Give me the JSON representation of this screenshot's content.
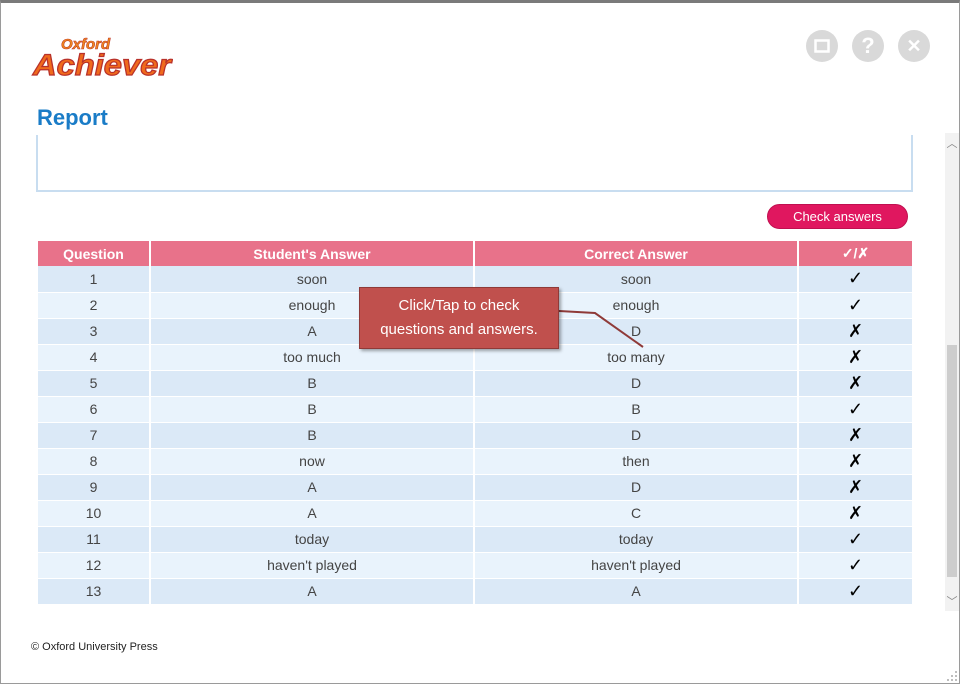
{
  "logo": {
    "top_word": "Oxford",
    "main_word": "Achiever"
  },
  "window_buttons": {
    "help_glyph": "?",
    "close_glyph": "✕"
  },
  "page_title": "Report",
  "check_answers_label": "Check answers",
  "table": {
    "headers": [
      "Question",
      "Student's Answer",
      "Correct Answer",
      "✓/✗"
    ],
    "rows": [
      {
        "q": "1",
        "student": "soon",
        "correct": "soon",
        "mark": "✓"
      },
      {
        "q": "2",
        "student": "enough",
        "correct": "enough",
        "mark": "✓"
      },
      {
        "q": "3",
        "student": "A",
        "correct": "D",
        "mark": "✗"
      },
      {
        "q": "4",
        "student": "too much",
        "correct": "too many",
        "mark": "✗"
      },
      {
        "q": "5",
        "student": "B",
        "correct": "D",
        "mark": "✗"
      },
      {
        "q": "6",
        "student": "B",
        "correct": "B",
        "mark": "✓"
      },
      {
        "q": "7",
        "student": "B",
        "correct": "D",
        "mark": "✗"
      },
      {
        "q": "8",
        "student": "now",
        "correct": "then",
        "mark": "✗"
      },
      {
        "q": "9",
        "student": "A",
        "correct": "D",
        "mark": "✗"
      },
      {
        "q": "10",
        "student": "A",
        "correct": "C",
        "mark": "✗"
      },
      {
        "q": "11",
        "student": "today",
        "correct": "today",
        "mark": "✓"
      },
      {
        "q": "12",
        "student": "haven't played",
        "correct": "haven't played",
        "mark": "✓"
      },
      {
        "q": "13",
        "student": "A",
        "correct": "A",
        "mark": "✓"
      }
    ]
  },
  "callout": {
    "line1": "Click/Tap to check",
    "line2": "questions and answers."
  },
  "footer": "© Oxford University Press",
  "colors": {
    "accent": "#e0175f",
    "header": "#e8728a",
    "title": "#1a7cc7",
    "callout": "#c0504d"
  }
}
